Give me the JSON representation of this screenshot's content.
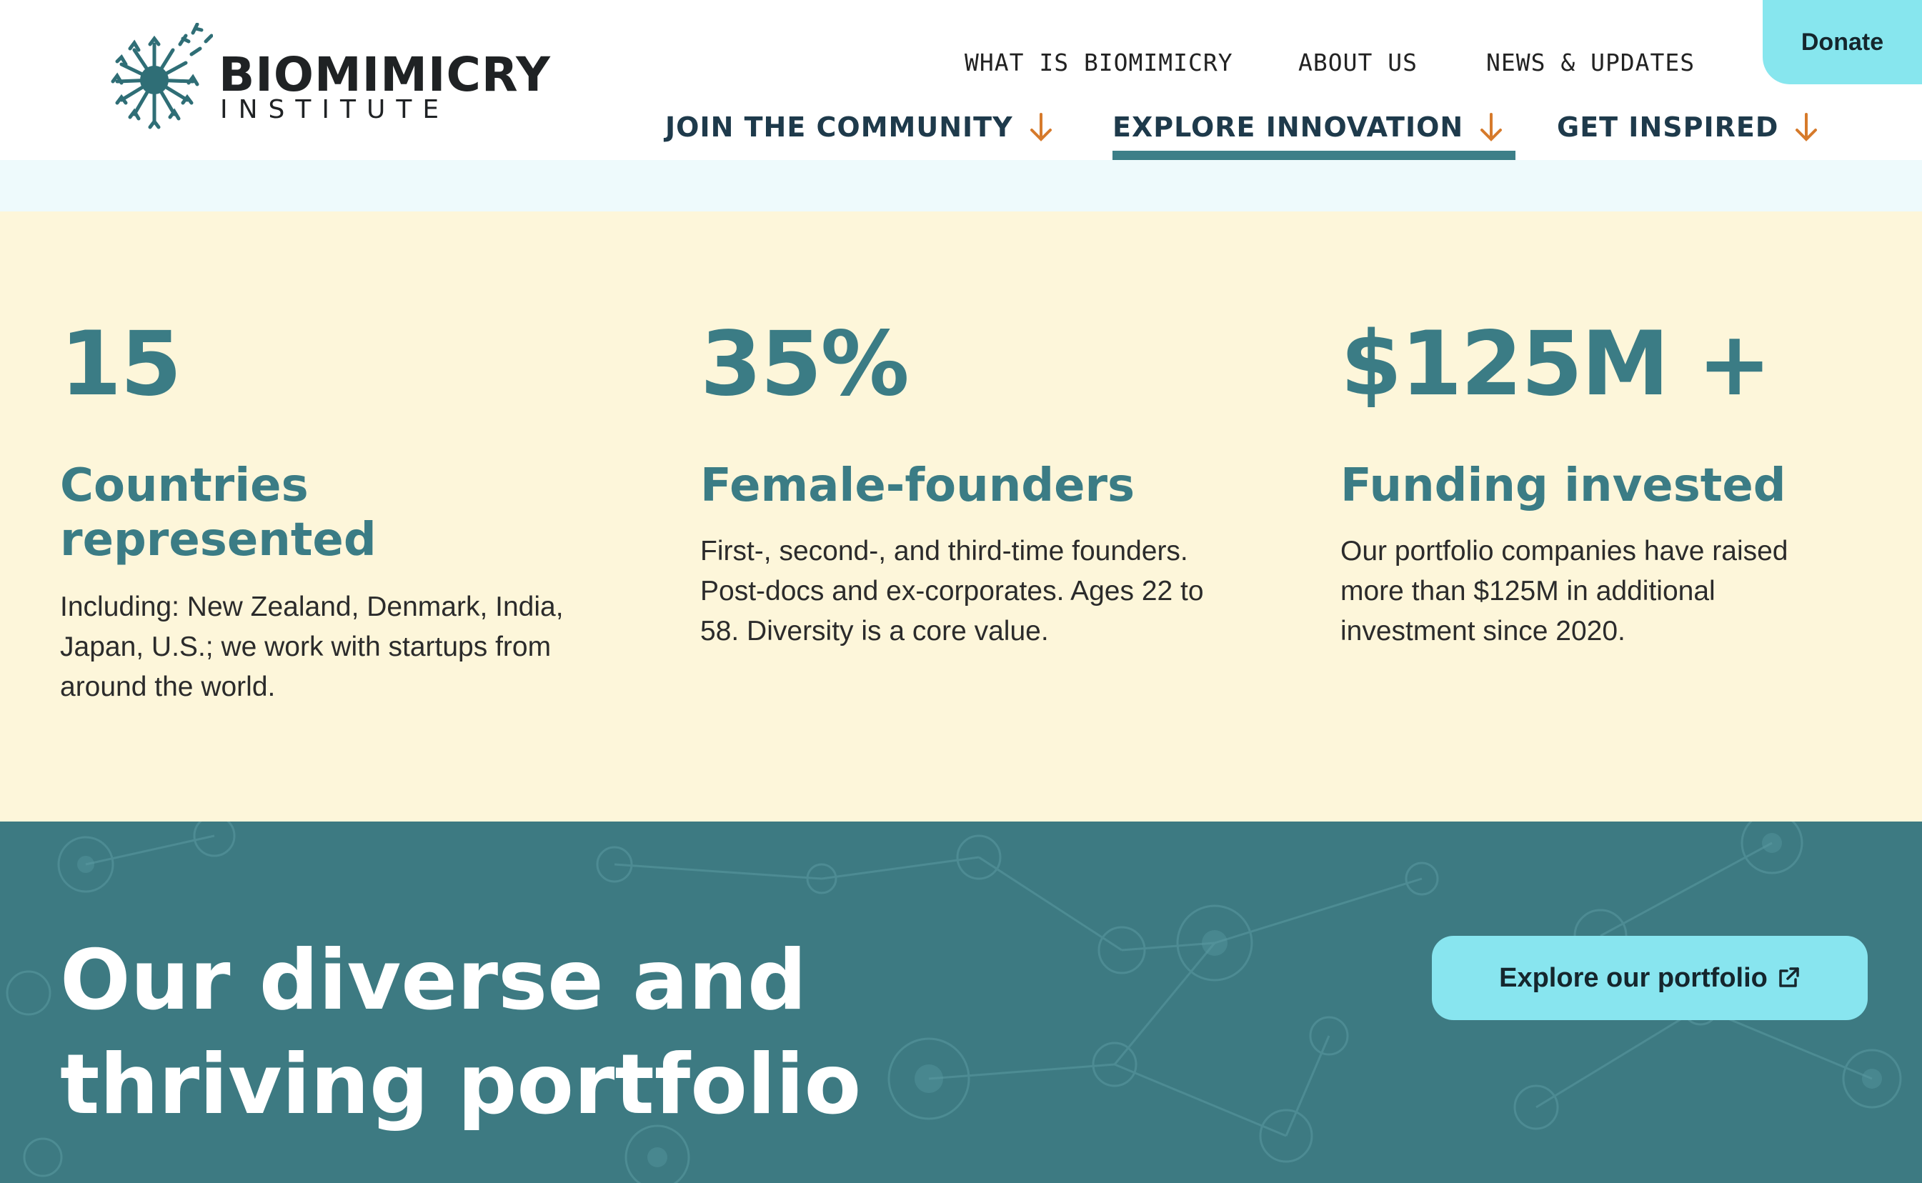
{
  "brand": {
    "name": "BIOMIMICRY",
    "subtitle": "INSTITUTE",
    "colors": {
      "teal": "#3b7c85",
      "navy": "#1e3a4b",
      "cyan": "#87e6ee",
      "cream": "#fdf6da",
      "orange": "#d67a2b"
    }
  },
  "top_nav": {
    "items": [
      "WHAT IS BIOMIMICRY",
      "ABOUT US",
      "NEWS & UPDATES"
    ],
    "donate_label": "Donate"
  },
  "main_nav": {
    "items": [
      {
        "label": "JOIN THE COMMUNITY",
        "icon": "arrow-down-icon"
      },
      {
        "label": "EXPLORE INNOVATION",
        "icon": "arrow-down-icon",
        "active": true
      },
      {
        "label": "GET INSPIRED",
        "icon": "arrow-down-icon"
      }
    ]
  },
  "stats": [
    {
      "value": "15",
      "label": "Countries represented",
      "description": "Including: New Zealand, Denmark, India, Japan, U.S.; we work with startups from around the world."
    },
    {
      "value": "35%",
      "label": "Female-founders",
      "description": "First-, second-, and third-time founders. Post-docs and ex-corporates. Ages 22 to 58. Diversity is a core value."
    },
    {
      "value": "$125M +",
      "label": "Funding invested",
      "description": "Our portfolio companies have raised more than $125M in additional investment since 2020."
    }
  ],
  "portfolio": {
    "title": "Our diverse and thriving portfolio",
    "cta_label": "Explore our portfolio",
    "cta_icon": "external-link-icon"
  }
}
